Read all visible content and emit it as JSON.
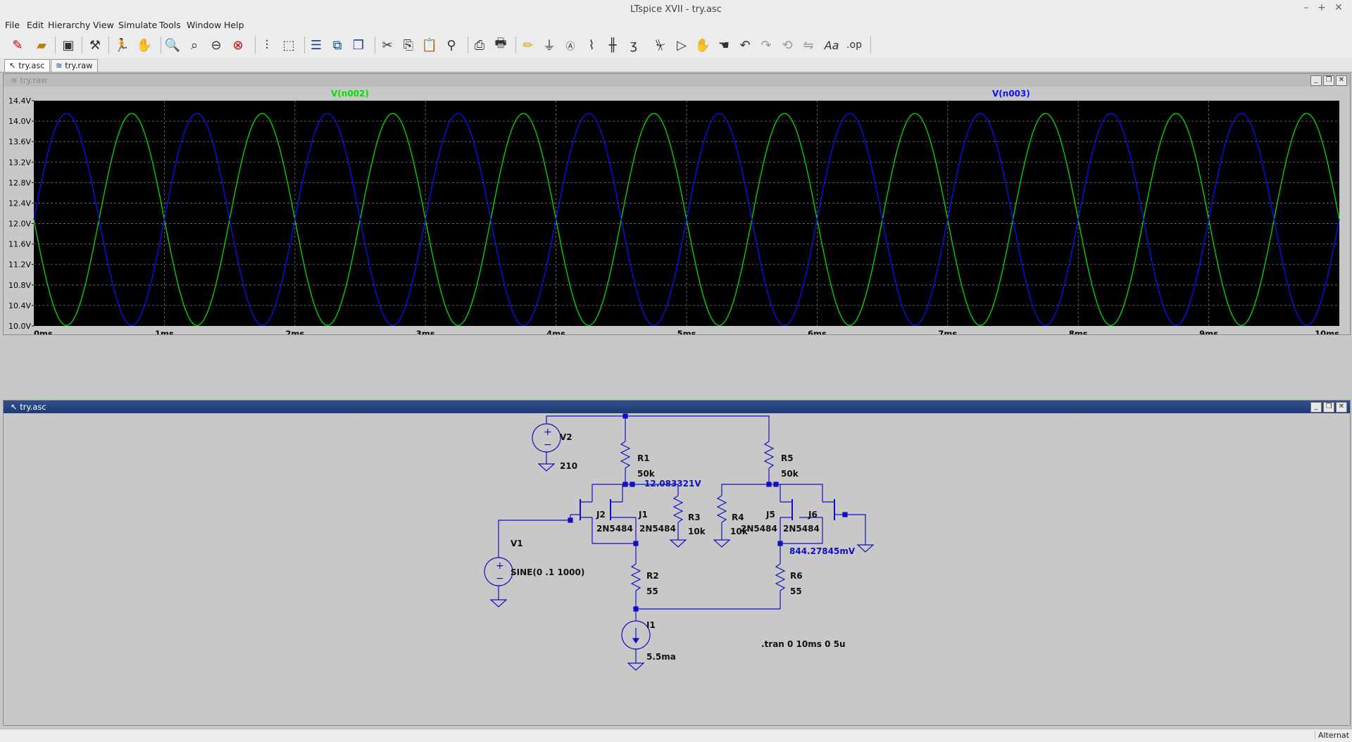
{
  "window": {
    "title": "LTspice XVII - try.asc"
  },
  "menu": [
    "File",
    "Edit",
    "Hierarchy",
    "View",
    "Simulate",
    "Tools",
    "Window",
    "Help"
  ],
  "toolbar_icons": [
    "new-schematic",
    "open",
    "save",
    "control-panel",
    "run",
    "halt",
    "zoom-in",
    "zoom-pan",
    "zoom-out",
    "zoom-fit",
    "autorange",
    "trace-visibility",
    "tile-horizontal",
    "tile-vertical",
    "cascade",
    "cut",
    "copy",
    "paste",
    "find",
    "print-setup",
    "print",
    "draw-wire",
    "ground",
    "label-net",
    "resistor",
    "capacitor",
    "inductor",
    "diode",
    "component",
    "move",
    "drag",
    "undo",
    "redo",
    "rotate",
    "mirror",
    "text",
    "spice-directive"
  ],
  "tabs": [
    "try.asc",
    "try.raw"
  ],
  "waveform": {
    "title": "try.raw",
    "traces": [
      {
        "label": "V(n002)",
        "color": "#00e000"
      },
      {
        "label": "V(n003)",
        "color": "#1010ff"
      }
    ]
  },
  "chart_data": {
    "type": "line",
    "title": "",
    "xlabel": "",
    "ylabel": "",
    "xlim": [
      0,
      10
    ],
    "ylim": [
      10.0,
      14.4
    ],
    "xticks": [
      "0ms",
      "1ms",
      "2ms",
      "3ms",
      "4ms",
      "5ms",
      "6ms",
      "7ms",
      "8ms",
      "9ms",
      "10ms"
    ],
    "yticks": [
      "10.0V",
      "10.4V",
      "10.8V",
      "11.2V",
      "11.6V",
      "12.0V",
      "12.4V",
      "12.8V",
      "13.2V",
      "13.6V",
      "14.0V",
      "14.4V"
    ],
    "grid": true,
    "series": [
      {
        "name": "V(n002)",
        "color": "#00e000",
        "waveform": "sine",
        "offset_V": 12.08,
        "amplitude_V": 2.07,
        "frequency_Hz": 1000,
        "phase_deg": 180
      },
      {
        "name": "V(n003)",
        "color": "#1010ff",
        "waveform": "sine",
        "offset_V": 12.08,
        "amplitude_V": 2.07,
        "frequency_Hz": 1000,
        "phase_deg": 0
      }
    ]
  },
  "schematic": {
    "title": "try.asc",
    "components": {
      "V2": {
        "name": "V2",
        "value": "210"
      },
      "R1": {
        "name": "R1",
        "value": "50k"
      },
      "R5": {
        "name": "R5",
        "value": "50k"
      },
      "J2": {
        "name": "J2",
        "model": "2N5484"
      },
      "J1": {
        "name": "J1",
        "model": "2N5484"
      },
      "R3": {
        "name": "R3",
        "value": "10k"
      },
      "R4": {
        "name": "R4",
        "value": "10k"
      },
      "J5": {
        "name": "J5",
        "model": "2N5484"
      },
      "J6": {
        "name": "J6",
        "model": "2N5484"
      },
      "V1": {
        "name": "V1",
        "value": "SINE(0 .1 1000)"
      },
      "R2": {
        "name": "R2",
        "value": "55"
      },
      "R6": {
        "name": "R6",
        "value": "55"
      },
      "I1": {
        "name": "I1",
        "value": "5.5ma"
      }
    },
    "node_voltages": [
      "12.083321V",
      "844.27845mV"
    ],
    "directive": ".tran 0 10ms 0 5u"
  },
  "status": {
    "text": "Alternat"
  }
}
